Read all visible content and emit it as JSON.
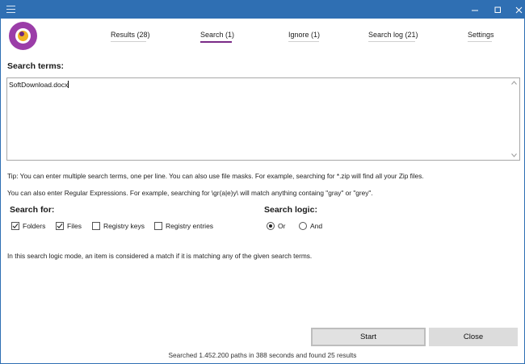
{
  "colors": {
    "titlebar": "#2f6fb3",
    "accent": "#7a2b87",
    "logo_ring": "#9b3da8",
    "logo_core": "#f0b323"
  },
  "tabs": [
    {
      "label": "Results (28)",
      "active": false
    },
    {
      "label": "Search (1)",
      "active": true
    },
    {
      "label": "Ignore (1)",
      "active": false
    },
    {
      "label": "Search log (21)",
      "active": false
    },
    {
      "label": "Settings",
      "active": false
    }
  ],
  "search_terms": {
    "title": "Search terms:",
    "value": "SoftDownload.docx"
  },
  "tips": {
    "line1": "Tip: You can enter multiple search terms, one per line. You can also use file masks. For example, searching for *.zip will find all your Zip files.",
    "line2": "You can also enter Regular Expressions. For example, searching for \\gr(a|e)y\\ will match anything containg \"gray\" or \"grey\"."
  },
  "search_for": {
    "title": "Search for:",
    "options": [
      {
        "label": "Folders",
        "checked": true
      },
      {
        "label": "Files",
        "checked": true
      },
      {
        "label": "Registry keys",
        "checked": false
      },
      {
        "label": "Registry entries",
        "checked": false
      }
    ]
  },
  "search_logic": {
    "title": "Search logic:",
    "options": [
      {
        "label": "Or",
        "selected": true
      },
      {
        "label": "And",
        "selected": false
      }
    ],
    "description": "In this search logic mode, an item is considered a match if it is matching any of the given search terms."
  },
  "buttons": {
    "start": "Start",
    "close": "Close"
  },
  "status": "Searched 1.452.200 paths in 388 seconds and found 25 results",
  "icons": {
    "menu": "hamburger-icon",
    "minimize": "minimize-icon",
    "maximize": "maximize-icon",
    "close": "close-icon",
    "logo": "app-logo",
    "scroll_up": "chevron-up-icon",
    "scroll_down": "chevron-down-icon",
    "check": "checkmark-icon"
  }
}
